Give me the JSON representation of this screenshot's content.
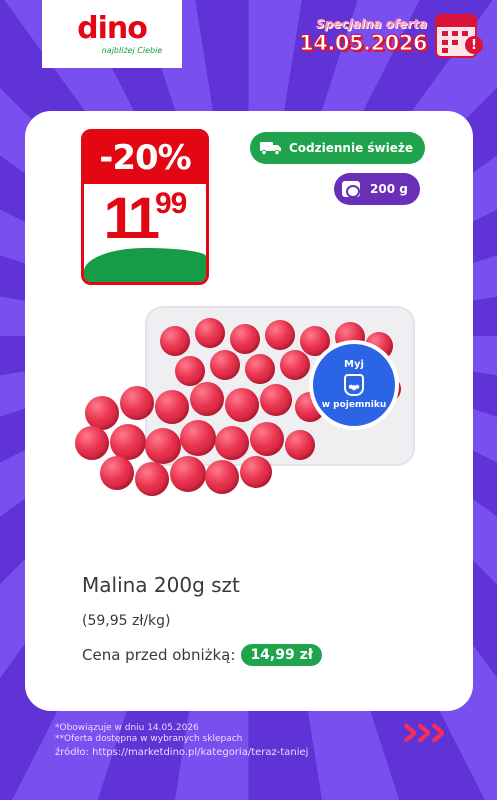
{
  "header": {
    "logo_text": "dino",
    "logo_tagline": "najbliżej Ciebie",
    "promo_label": "Specjalna oferta",
    "promo_date": "14.05.2026",
    "calendar_icon": "calendar-alert-icon"
  },
  "product": {
    "discount": "-20%",
    "price_main": "11",
    "price_cents": "99",
    "badge_fresh": "Codziennie świeże",
    "badge_fresh_icon": "delivery-truck-icon",
    "badge_weight": "200 g",
    "badge_weight_icon": "scale-icon",
    "wash_line1": "Myj",
    "wash_line2": "w pojemniku",
    "name": "Malina 200g szt",
    "unit_price": "(59,95 zł/kg)",
    "prev_price_label": "Cena przed obniżką:",
    "prev_price": "14,99 zł"
  },
  "footer": {
    "line1": "*Obowiązuje w dniu 14.05.2026",
    "line2": "**Oferta dostępna w wybranych sklepach",
    "source": "źródło: https://marketdino.pl/kategoria/teraz-taniej"
  },
  "colors": {
    "background": "#6a3fe0",
    "dino_red": "#e30613",
    "dino_green": "#1fa34d",
    "weight_purple": "#6a2fb7",
    "wash_blue": "#2c64e6"
  }
}
